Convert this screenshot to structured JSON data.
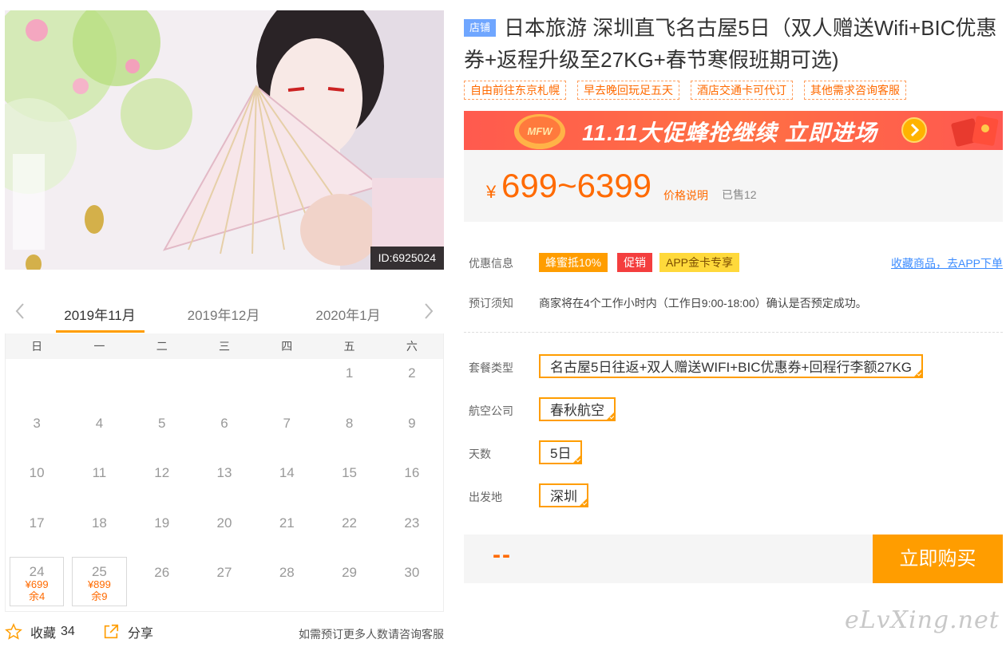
{
  "photo": {
    "id_label": "ID:6925024"
  },
  "calendar": {
    "prev_icon": "chevron-left-icon",
    "next_icon": "chevron-right-icon",
    "months": [
      "2019年11月",
      "2019年12月",
      "2020年1月"
    ],
    "active_month_index": 0,
    "weekdays": [
      "日",
      "一",
      "二",
      "三",
      "四",
      "五",
      "六"
    ],
    "rows": [
      [
        {
          "d": ""
        },
        {
          "d": ""
        },
        {
          "d": ""
        },
        {
          "d": ""
        },
        {
          "d": ""
        },
        {
          "d": "1"
        },
        {
          "d": "2"
        }
      ],
      [
        {
          "d": "3"
        },
        {
          "d": "4"
        },
        {
          "d": "5"
        },
        {
          "d": "6"
        },
        {
          "d": "7"
        },
        {
          "d": "8"
        },
        {
          "d": "9"
        }
      ],
      [
        {
          "d": "10"
        },
        {
          "d": "11"
        },
        {
          "d": "12"
        },
        {
          "d": "13"
        },
        {
          "d": "14"
        },
        {
          "d": "15"
        },
        {
          "d": "16"
        }
      ],
      [
        {
          "d": "17"
        },
        {
          "d": "18"
        },
        {
          "d": "19"
        },
        {
          "d": "20"
        },
        {
          "d": "21"
        },
        {
          "d": "22"
        },
        {
          "d": "23"
        }
      ],
      [
        {
          "d": "24",
          "price": "¥699",
          "stock": "余4"
        },
        {
          "d": "25",
          "price": "¥899",
          "stock": "余9"
        },
        {
          "d": "26"
        },
        {
          "d": "27"
        },
        {
          "d": "28"
        },
        {
          "d": "29"
        },
        {
          "d": "30"
        }
      ]
    ]
  },
  "bottom": {
    "favorite_label": "收藏",
    "favorite_count": "34",
    "share_label": "分享",
    "note": "如需预订更多人数请咨询客服"
  },
  "product": {
    "shop_badge": "店铺",
    "title": "日本旅游 深圳直飞名古屋5日（双人赠送Wifi+BIC优惠券+返程升级至27KG+春节寒假班期可选)",
    "tags": [
      "自由前往东京札幌",
      "早去晚回玩足五天",
      "酒店交通卡可代订",
      "其他需求咨询客服"
    ]
  },
  "banner": {
    "text": "11.11大促蜂抢继续 立即进场",
    "badge": "MFW"
  },
  "price": {
    "symbol": "¥",
    "range": "699~6399",
    "explain_link": "价格说明",
    "sold": "已售12"
  },
  "promo": {
    "label": "优惠信息",
    "badges": [
      {
        "text": "蜂蜜抵10%",
        "bg": "#ff9d00",
        "fg": "#ffffff"
      },
      {
        "text": "促销",
        "bg": "#f43e3e",
        "fg": "#ffffff"
      },
      {
        "text": "APP金卡专享",
        "bg": "#ffd93b",
        "fg": "#7a4b00"
      }
    ],
    "app_link": "收藏商品，去APP下单"
  },
  "notice": {
    "label": "预订须知",
    "text": "商家将在4个工作小时内（工作日9:00-18:00）确认是否预定成功。"
  },
  "options": [
    {
      "label": "套餐类型",
      "value": "名古屋5日往返+双人赠送WIFI+BIC优惠券+回程行李额27KG"
    },
    {
      "label": "航空公司",
      "value": "春秋航空"
    },
    {
      "label": "天数",
      "value": "5日"
    },
    {
      "label": "出发地",
      "value": "深圳"
    }
  ],
  "buy": {
    "total_placeholder": "--",
    "button": "立即购买"
  },
  "watermark": "eLvXing.net",
  "colors": {
    "accent": "#ff9d00",
    "price": "#ff6a00",
    "link": "#3c8cff",
    "shop_badge": "#6fa6ff"
  }
}
